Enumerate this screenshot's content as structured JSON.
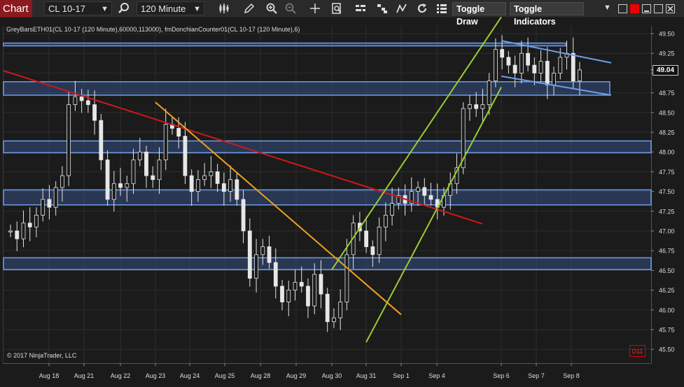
{
  "toolbar": {
    "chart_tab": "Chart",
    "instrument": "CL 10-17",
    "interval": "120 Minute",
    "toggle_draw": "Toggle Draw",
    "toggle_indicators": "Toggle Indicators"
  },
  "chart": {
    "title": "GreyBarsETH01(CL 10-17 (120 Minute),60000,113000), fmDonchianCounter01(CL 10-17 (120 Minute),6)",
    "copyright": "© 2017 NinjaTrader, LLC",
    "current_price": "49.04",
    "badge": "D11"
  },
  "chart_data": {
    "type": "candlestick",
    "instrument": "CL 10-17",
    "interval": "120 Minute",
    "ylim": [
      45.45,
      49.58
    ],
    "y_ticks": [
      "49.50",
      "49.25",
      "49.00",
      "48.75",
      "48.50",
      "48.25",
      "48.00",
      "47.75",
      "47.50",
      "47.25",
      "47.00",
      "46.75",
      "46.50",
      "46.25",
      "46.00",
      "45.75",
      "45.50"
    ],
    "x_labels": [
      "Aug 18",
      "Aug 21",
      "Aug 22",
      "Aug 23",
      "Aug 24",
      "Aug 25",
      "Aug 28",
      "Aug 29",
      "Aug 30",
      "Aug 31",
      "Sep 1",
      "Sep 4",
      "Sep 6",
      "Sep 7",
      "Sep 8"
    ],
    "close_series": [
      47.0,
      46.9,
      47.1,
      47.05,
      47.2,
      47.4,
      47.3,
      47.55,
      47.7,
      48.6,
      48.7,
      48.65,
      48.6,
      48.4,
      47.9,
      47.4,
      47.6,
      47.55,
      47.6,
      47.9,
      48.0,
      47.7,
      47.65,
      47.9,
      48.35,
      48.3,
      48.2,
      47.7,
      47.5,
      47.65,
      47.7,
      47.75,
      47.6,
      47.5,
      47.65,
      47.4,
      47.0,
      46.4,
      46.7,
      46.8,
      46.6,
      46.3,
      46.1,
      46.25,
      46.35,
      46.3,
      46.05,
      46.45,
      46.2,
      45.85,
      45.9,
      46.1,
      46.7,
      47.1,
      47.0,
      46.8,
      46.7,
      47.05,
      47.2,
      47.35,
      47.45,
      47.35,
      47.5,
      47.55,
      47.45,
      47.4,
      47.3,
      47.45,
      47.6,
      47.8,
      48.55,
      48.6,
      48.55,
      48.6,
      48.9,
      49.3,
      49.2,
      49.1,
      49.0,
      49.25,
      49.1,
      49.0,
      49.15,
      48.85,
      49.0,
      49.2,
      49.25,
      48.9,
      49.04
    ],
    "zones": [
      {
        "low": 49.35,
        "high": 49.38
      },
      {
        "low": 48.72,
        "high": 48.89
      },
      {
        "low": 47.99,
        "high": 48.14
      },
      {
        "low": 47.33,
        "high": 47.52
      },
      {
        "low": 46.51,
        "high": 46.66
      }
    ],
    "trendlines": [
      {
        "color": "#d01818",
        "from": {
          "x": "Aug 17",
          "y": 49.03
        },
        "to": {
          "x": "Sep 5",
          "y": 47.09
        }
      },
      {
        "color": "#f0a020",
        "from": {
          "x": "Aug 23",
          "y": 48.63
        },
        "to": {
          "x": "Sep 1",
          "y": 45.94
        }
      },
      {
        "color": "#9acd32",
        "from": {
          "x": "Aug 30",
          "y": 46.51
        },
        "to": {
          "x": "Sep 6",
          "y": 49.71
        }
      },
      {
        "color": "#9acd32",
        "from": {
          "x": "Aug 31",
          "y": 45.59
        },
        "to": {
          "x": "Sep 6",
          "y": 48.82
        }
      },
      {
        "color": "#6d9eeb",
        "from": {
          "x": "Sep 6",
          "y": 49.41
        },
        "to": {
          "x": "Sep 8",
          "y": 49.13
        }
      },
      {
        "color": "#6d9eeb",
        "from": {
          "x": "Sep 6",
          "y": 48.96
        },
        "to": {
          "x": "Sep 8",
          "y": 48.72
        }
      }
    ]
  }
}
